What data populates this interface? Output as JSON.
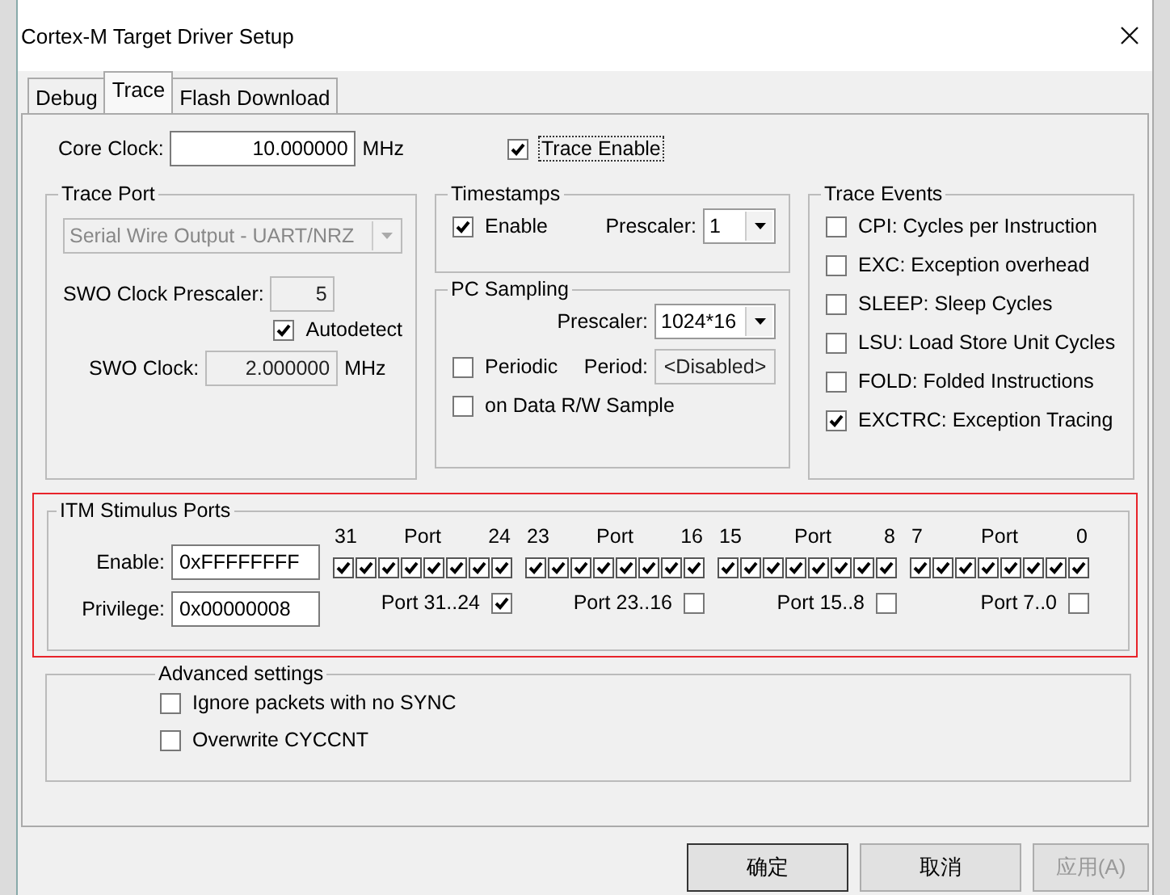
{
  "window": {
    "title": "Cortex-M Target Driver Setup"
  },
  "tabs": [
    {
      "label": "Debug",
      "selected": false
    },
    {
      "label": "Trace",
      "selected": true
    },
    {
      "label": "Flash Download",
      "selected": false
    }
  ],
  "core_clock": {
    "label": "Core Clock:",
    "value": "10.000000",
    "unit": "MHz"
  },
  "trace_enable": {
    "label": "Trace Enable",
    "checked": true
  },
  "trace_port": {
    "title": "Trace Port",
    "mode": "Serial Wire Output - UART/NRZ",
    "prescaler_label": "SWO Clock Prescaler:",
    "prescaler": "5",
    "autodetect": {
      "label": "Autodetect",
      "checked": true
    },
    "clock_label": "SWO Clock:",
    "clock": "2.000000",
    "clock_unit": "MHz"
  },
  "timestamps": {
    "title": "Timestamps",
    "enable": {
      "label": "Enable",
      "checked": true
    },
    "prescaler_label": "Prescaler:",
    "prescaler": "1"
  },
  "pc_sampling": {
    "title": "PC Sampling",
    "prescaler_label": "Prescaler:",
    "prescaler": "1024*16",
    "periodic": {
      "label": "Periodic",
      "checked": false
    },
    "period_label": "Period:",
    "period": "<Disabled>",
    "data_rw": {
      "label": "on Data R/W Sample",
      "checked": false
    }
  },
  "trace_events": {
    "title": "Trace Events",
    "items": [
      {
        "label": "CPI: Cycles per Instruction",
        "checked": false
      },
      {
        "label": "EXC: Exception overhead",
        "checked": false
      },
      {
        "label": "SLEEP: Sleep Cycles",
        "checked": false
      },
      {
        "label": "LSU: Load Store Unit Cycles",
        "checked": false
      },
      {
        "label": "FOLD: Folded Instructions",
        "checked": false
      },
      {
        "label": "EXCTRC: Exception Tracing",
        "checked": true
      }
    ]
  },
  "itm": {
    "title": "ITM Stimulus Ports",
    "highlighted": true,
    "enable_label": "Enable:",
    "enable": "0xFFFFFFFF",
    "privilege_label": "Privilege:",
    "privilege": "0x00000008",
    "groups": [
      {
        "high": "31",
        "caption": "Port",
        "low": "24",
        "port_label": "Port 31..24",
        "privileged": true,
        "bits": [
          {
            "checked": true
          },
          {
            "checked": true
          },
          {
            "checked": true
          },
          {
            "checked": true
          },
          {
            "checked": true
          },
          {
            "checked": true
          },
          {
            "checked": true
          },
          {
            "checked": true
          }
        ]
      },
      {
        "high": "23",
        "caption": "Port",
        "low": "16",
        "port_label": "Port 23..16",
        "privileged": false,
        "bits": [
          {
            "checked": true
          },
          {
            "checked": true
          },
          {
            "checked": true
          },
          {
            "checked": true
          },
          {
            "checked": true
          },
          {
            "checked": true
          },
          {
            "checked": true
          },
          {
            "checked": true
          }
        ]
      },
      {
        "high": "15",
        "caption": "Port",
        "low": "8",
        "port_label": "Port 15..8",
        "privileged": false,
        "bits": [
          {
            "checked": true
          },
          {
            "checked": true
          },
          {
            "checked": true
          },
          {
            "checked": true
          },
          {
            "checked": true
          },
          {
            "checked": true
          },
          {
            "checked": true
          },
          {
            "checked": true
          }
        ]
      },
      {
        "high": "7",
        "caption": "Port",
        "low": "0",
        "port_label": "Port 7..0",
        "privileged": false,
        "bits": [
          {
            "checked": true
          },
          {
            "checked": true
          },
          {
            "checked": true
          },
          {
            "checked": true
          },
          {
            "checked": true
          },
          {
            "checked": true
          },
          {
            "checked": true
          },
          {
            "checked": true
          }
        ]
      }
    ]
  },
  "advanced": {
    "title": "Advanced settings",
    "items": [
      {
        "label": "Ignore packets with no SYNC",
        "checked": false
      },
      {
        "label": "Overwrite CYCCNT",
        "checked": false
      }
    ]
  },
  "buttons": [
    {
      "label": "确定",
      "disabled": false
    },
    {
      "label": "取消",
      "disabled": false
    },
    {
      "label": "应用(A)",
      "disabled": true
    }
  ]
}
